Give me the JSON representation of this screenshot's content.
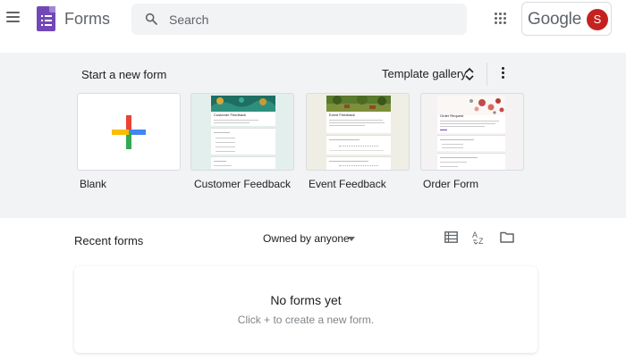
{
  "header": {
    "app_title": "Forms",
    "search_placeholder": "Search",
    "account_brand": "Google",
    "account_initial": "S",
    "avatar_color": "#c5221f"
  },
  "templates": {
    "title": "Start a new form",
    "gallery_label": "Template gallery",
    "items": [
      {
        "label": "Blank",
        "icon": "plus-icon"
      },
      {
        "label": "Customer Feedback",
        "preview_title": "Customer Feedback"
      },
      {
        "label": "Event Feedback",
        "preview_title": "Event Feedback"
      },
      {
        "label": "Order Form",
        "preview_title": "Order Request"
      }
    ]
  },
  "recent": {
    "title": "Recent forms",
    "owner_filter": "Owned by anyone",
    "empty_title": "No forms yet",
    "empty_subtitle": "Click + to create a new form."
  },
  "colors": {
    "brand_purple": "#7248b9",
    "band_background": "#f1f3f4"
  }
}
